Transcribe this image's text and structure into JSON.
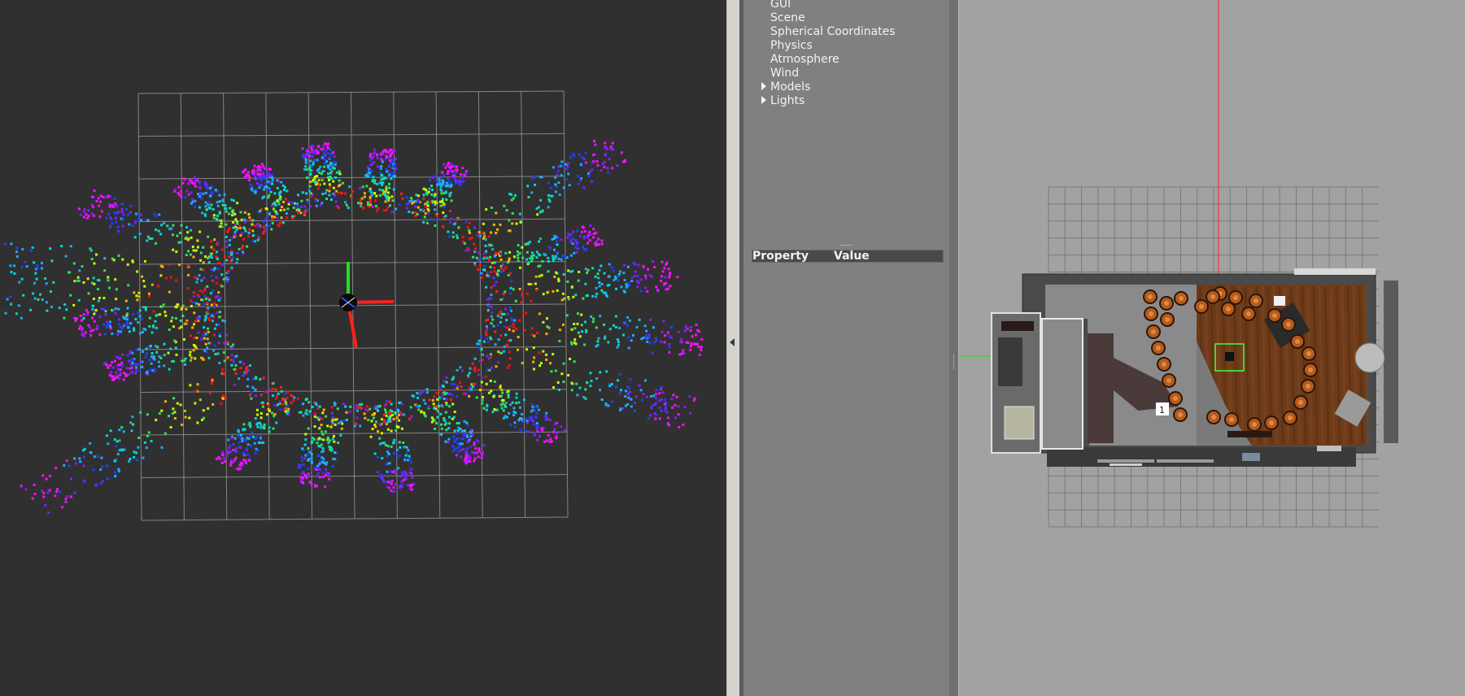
{
  "world_tree": {
    "items": [
      {
        "label": "GUI",
        "expandable": false
      },
      {
        "label": "Scene",
        "expandable": false
      },
      {
        "label": "Spherical Coordinates",
        "expandable": false
      },
      {
        "label": "Physics",
        "expandable": false
      },
      {
        "label": "Atmosphere",
        "expandable": false
      },
      {
        "label": "Wind",
        "expandable": false
      },
      {
        "label": "Models",
        "expandable": true
      },
      {
        "label": "Lights",
        "expandable": true
      }
    ]
  },
  "property_table": {
    "property_header": "Property",
    "value_header": "Value"
  },
  "scene": {
    "label_marker": "1"
  },
  "colors": {
    "rviz_background": "#303030",
    "grid_line": "#9a9a9a",
    "gazebo_panel": "#808080",
    "gazebo_scene": "#a2a2a2",
    "axis_x": "#ff2020",
    "axis_y": "#20e020",
    "selection_box": "#40ff40"
  }
}
